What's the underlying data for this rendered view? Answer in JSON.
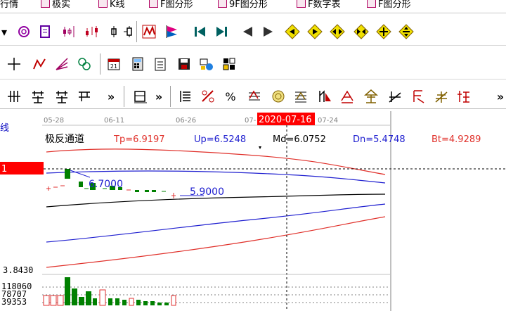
{
  "menubar": {
    "items": [
      {
        "label": "行情"
      },
      {
        "label": "极实"
      },
      {
        "label": "K线"
      },
      {
        "label": "F图分形"
      },
      {
        "label": "9F图分形"
      },
      {
        "label": "F数字表"
      },
      {
        "label": "F图分形"
      }
    ]
  },
  "chart": {
    "dates": [
      "05-28",
      "06-11",
      "06-26",
      "07-",
      "2020-07-16",
      "07-24"
    ],
    "cursor_date": "2020-07-16",
    "indicator_name": "极反通道",
    "params": {
      "tp": "Tp=6.9197",
      "up": "Up=6.5248",
      "md": "Md=6.0752",
      "dn": "Dn=5.4748",
      "bt": "Bt=4.9289"
    },
    "left_label": "线",
    "left_price_tag": "1",
    "annotation_high": "6.7000",
    "annotation_low": "5.9000",
    "vol_top": "3.8430",
    "vol_values": [
      "118060",
      "78707",
      "39353"
    ],
    "colors": {
      "tp": "#e0302a",
      "up": "#2020d0",
      "md": "#000000",
      "dn": "#2020d0",
      "bt": "#e0302a",
      "down_bar": "#008000",
      "up_bar": "#e03030",
      "cursor": "#ff0000"
    }
  }
}
